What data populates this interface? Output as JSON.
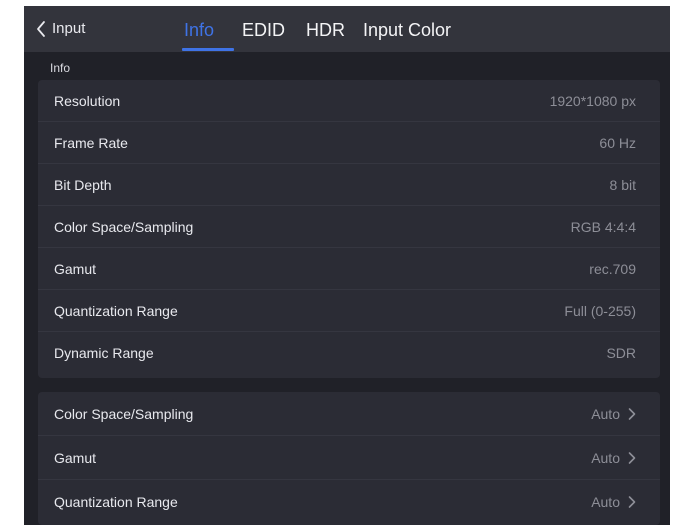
{
  "header": {
    "back_label": "Input",
    "tabs": [
      {
        "label": "Info",
        "active": true
      },
      {
        "label": "EDID",
        "active": false
      },
      {
        "label": "HDR",
        "active": false
      },
      {
        "label": "Input Color",
        "active": false
      }
    ]
  },
  "info_section": {
    "title": "Info",
    "rows": [
      {
        "label": "Resolution",
        "value": "1920*1080 px"
      },
      {
        "label": "Frame Rate",
        "value": "60 Hz"
      },
      {
        "label": "Bit Depth",
        "value": "8 bit"
      },
      {
        "label": "Color Space/Sampling",
        "value": "RGB 4:4:4"
      },
      {
        "label": "Gamut",
        "value": "rec.709"
      },
      {
        "label": "Quantization Range",
        "value": "Full (0-255)"
      },
      {
        "label": "Dynamic Range",
        "value": "SDR"
      }
    ]
  },
  "settings": {
    "rows": [
      {
        "label": "Color Space/Sampling",
        "value": "Auto"
      },
      {
        "label": "Gamut",
        "value": "Auto"
      },
      {
        "label": "Quantization Range",
        "value": "Auto"
      }
    ]
  },
  "icons": {
    "back": "chevron-left-icon",
    "row_arrow": "chevron-right-icon"
  },
  "colors": {
    "accent": "#3f73e6",
    "background": "#202128",
    "topbar": "#33343c",
    "panel": "#2b2c35",
    "text_primary": "#e8e9ee",
    "text_secondary": "#8d8e97"
  }
}
